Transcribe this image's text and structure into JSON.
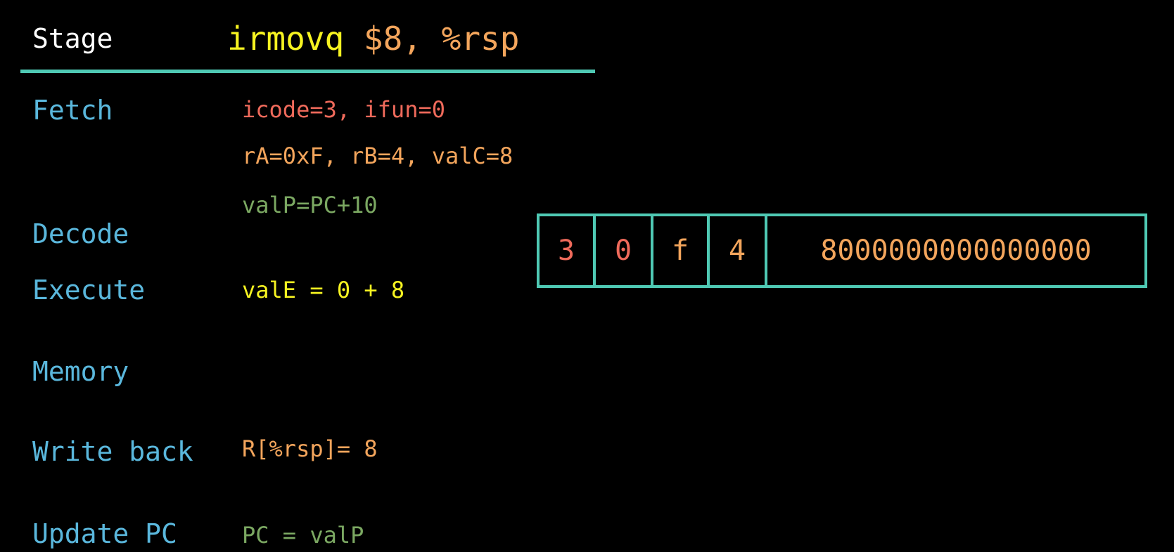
{
  "header": {
    "stage_label": "Stage",
    "mnemonic": "irmovq",
    "operands": "$8, %rsp"
  },
  "stages": {
    "fetch": "Fetch",
    "decode": "Decode",
    "execute": "Execute",
    "memory": "Memory",
    "write_back": "Write back",
    "update_pc": "Update PC"
  },
  "values": {
    "fetch_line1": "icode=3, ifun=0",
    "fetch_line2": "rA=0xF, rB=4, valC=8",
    "fetch_line3": "valP=PC+10",
    "execute": "valE = 0 + 8",
    "write_back": "R[%rsp]= 8",
    "update_pc": "PC = valP"
  },
  "encoding": {
    "icode": "3",
    "ifun": "0",
    "rA": "f",
    "rB": "4",
    "valC": "8000000000000000"
  },
  "colors": {
    "header_text": "#ffffff",
    "mnemonic": "#f6f321",
    "operands": "#f3a55c",
    "rule": "#4fc9b4",
    "stage_label": "#5ab7dc",
    "icode_line": "#ef6a5b",
    "fields_line": "#f3a55c",
    "valp_line": "#7ba862",
    "execute_line": "#f6f321",
    "writeback_line": "#f3a55c",
    "updatepc_line": "#7ba862",
    "box_border": "#4fc9b4"
  }
}
